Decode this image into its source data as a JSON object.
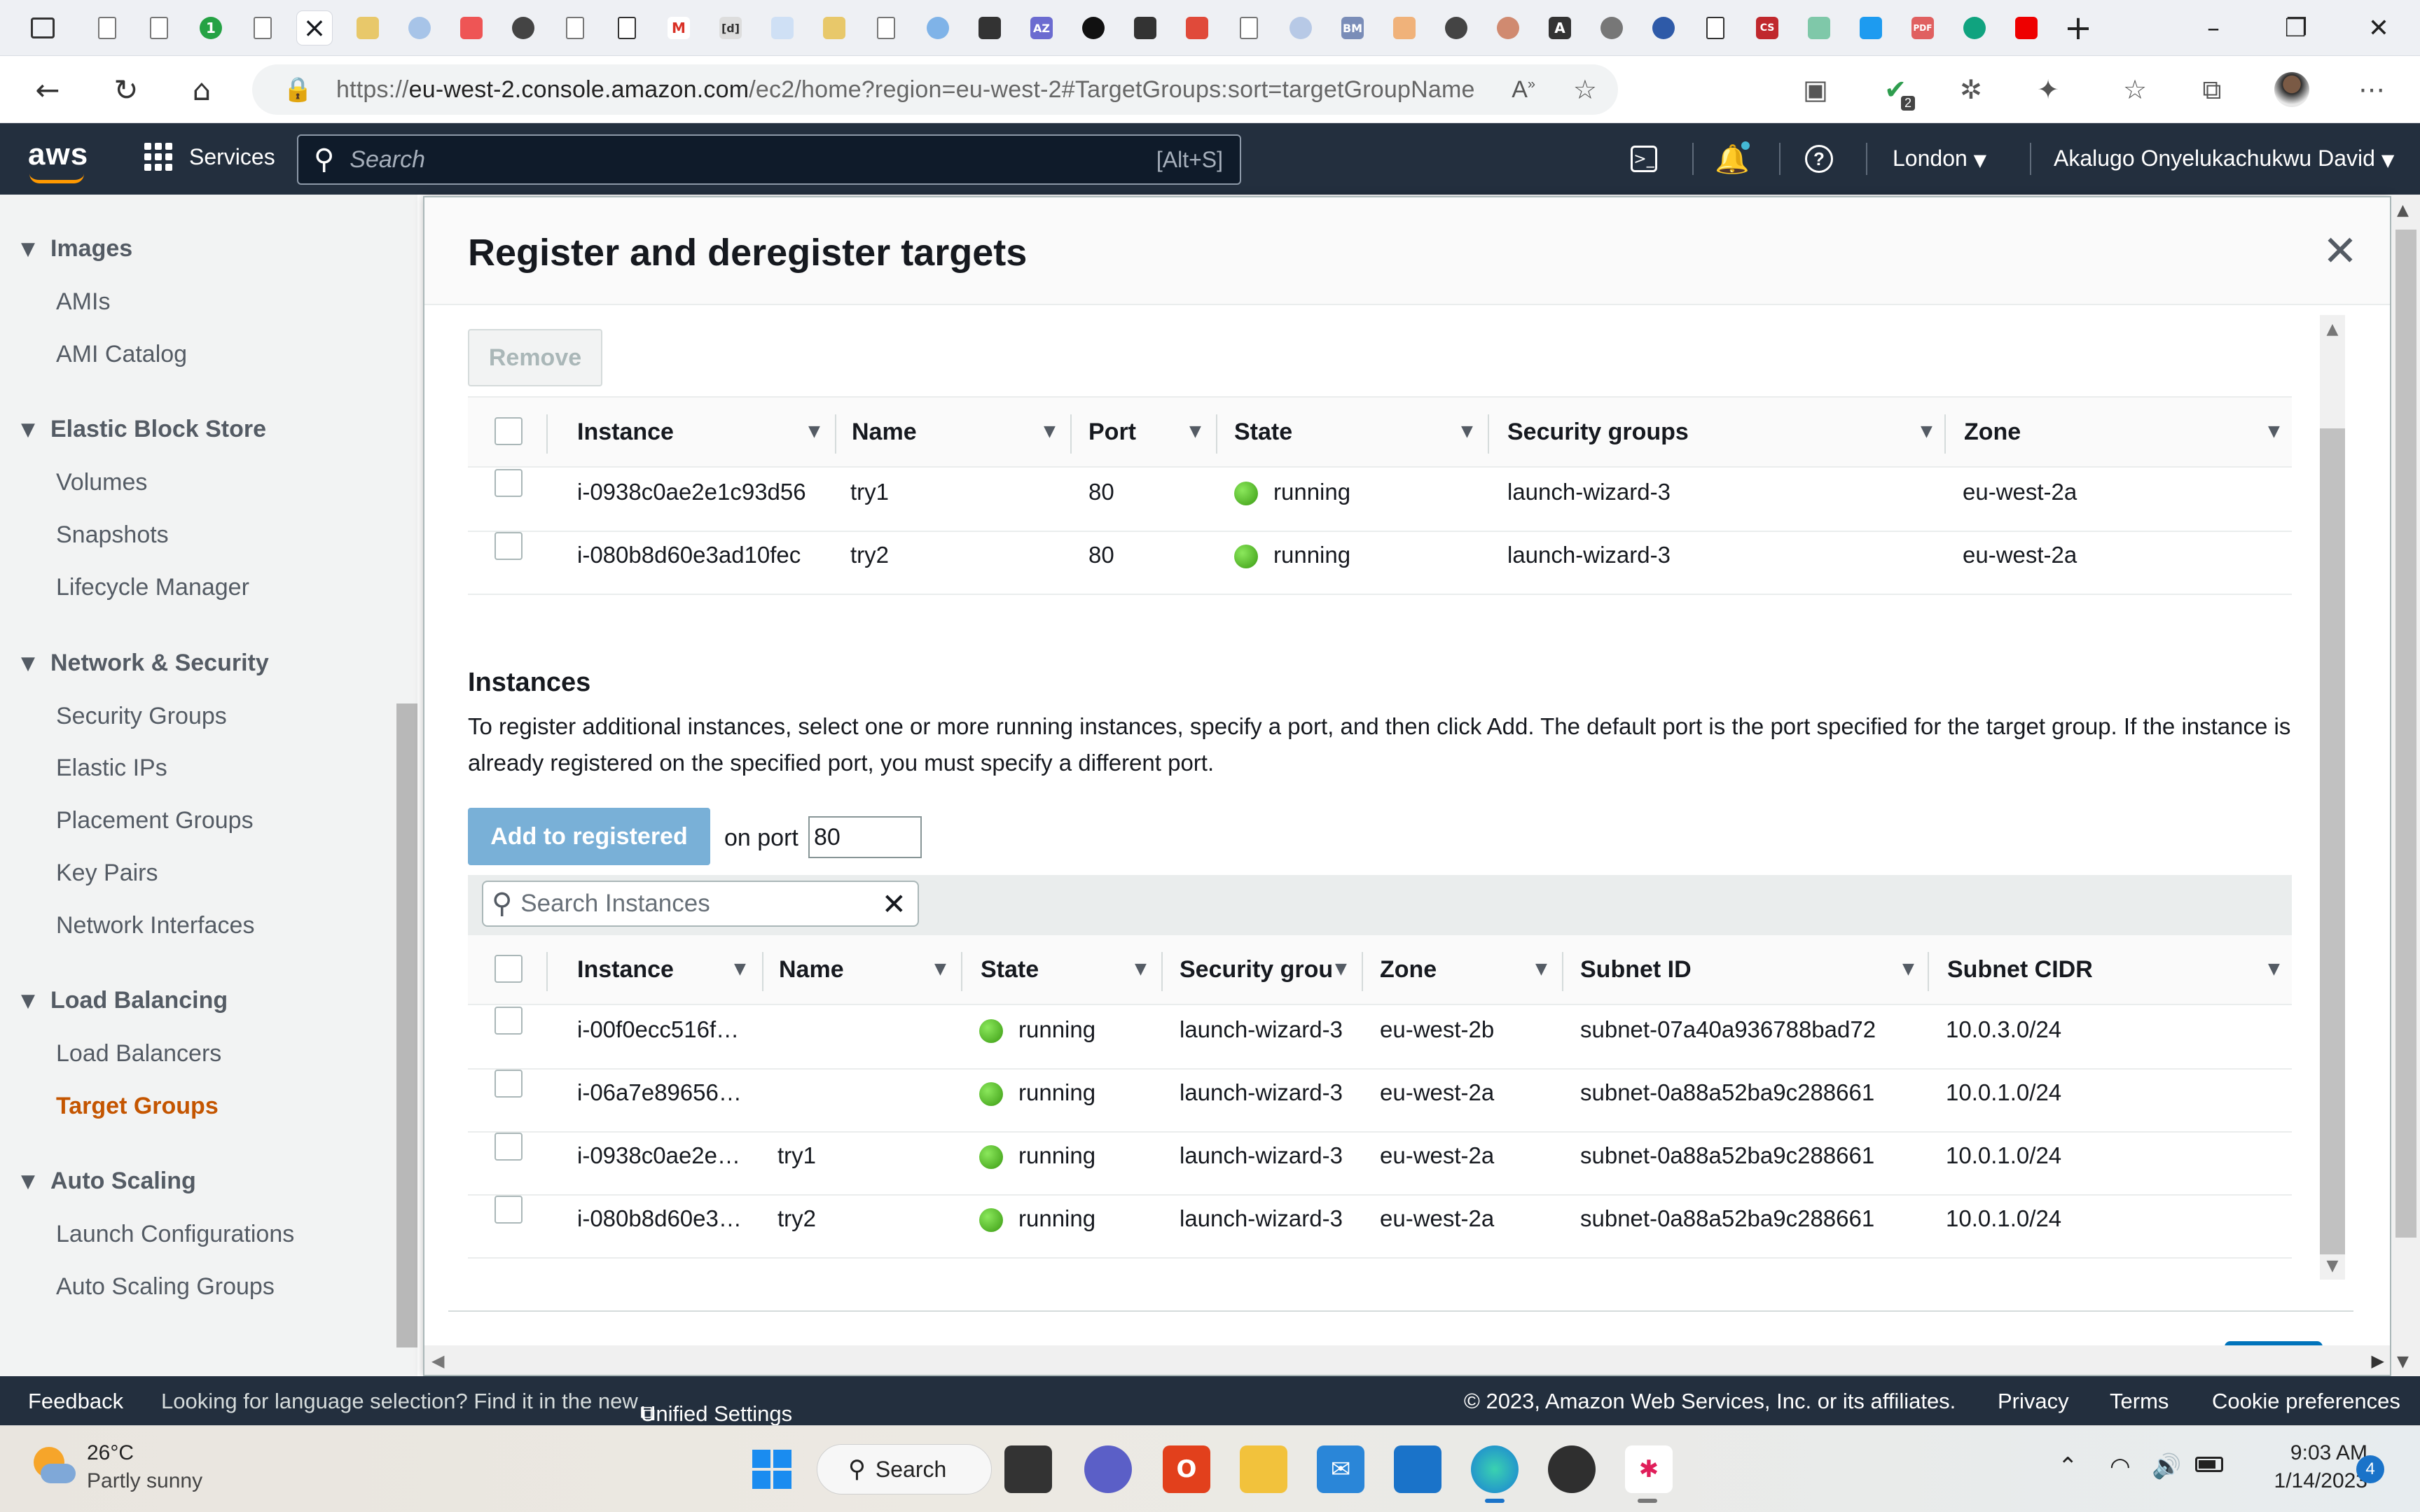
{
  "browser": {
    "url_prefix": "https://",
    "url_host": "eu-west-2.console.amazon.com",
    "url_path": "/ec2/home?region=eu-west-2#TargetGroups:sort=targetGroupName",
    "extensions_badge": "2",
    "tab_close": "×"
  },
  "aws_nav": {
    "logo": "aws",
    "services_label": "Services",
    "search_placeholder": "Search",
    "search_shortcut": "[Alt+S]",
    "region": "London",
    "user": "Akalugo Onyelukachukwu David"
  },
  "sidebar": {
    "sections": [
      {
        "title": "Images",
        "items": [
          "AMIs",
          "AMI Catalog"
        ]
      },
      {
        "title": "Elastic Block Store",
        "items": [
          "Volumes",
          "Snapshots",
          "Lifecycle Manager"
        ]
      },
      {
        "title": "Network & Security",
        "items": [
          "Security Groups",
          "Elastic IPs",
          "Placement Groups",
          "Key Pairs",
          "Network Interfaces"
        ]
      },
      {
        "title": "Load Balancing",
        "items": [
          "Load Balancers",
          "Target Groups"
        ]
      },
      {
        "title": "Auto Scaling",
        "items": [
          "Launch Configurations",
          "Auto Scaling Groups"
        ]
      }
    ],
    "active_item": "Target Groups"
  },
  "modal": {
    "title": "Register and deregister targets",
    "remove_label": "Remove",
    "registered": {
      "headers": [
        "Instance",
        "Name",
        "Port",
        "State",
        "Security groups",
        "Zone"
      ],
      "rows": [
        {
          "instance": "i-0938c0ae2e1c93d56",
          "name": "try1",
          "port": "80",
          "state": "running",
          "sg": "launch-wizard-3",
          "zone": "eu-west-2a"
        },
        {
          "instance": "i-080b8d60e3ad10fec",
          "name": "try2",
          "port": "80",
          "state": "running",
          "sg": "launch-wizard-3",
          "zone": "eu-west-2a"
        }
      ]
    },
    "instances_heading": "Instances",
    "instances_description": "To register additional instances, select one or more running instances, specify a port, and then click Add. The default port is the port specified for the target group. If the instance is already registered on the specified port, you must specify a different port.",
    "add_label": "Add to registered",
    "on_port_label": "on port",
    "port_value": "80",
    "search_placeholder": "Search Instances",
    "available": {
      "headers": [
        "Instance",
        "Name",
        "State",
        "Security grou",
        "Zone",
        "Subnet ID",
        "Subnet CIDR"
      ],
      "rows": [
        {
          "instance": "i-00f0ecc516f…",
          "name": "",
          "state": "running",
          "sg": "launch-wizard-3",
          "zone": "eu-west-2b",
          "subnet": "subnet-07a40a936788bad72",
          "cidr": "10.0.3.0/24"
        },
        {
          "instance": "i-06a7e89656…",
          "name": "",
          "state": "running",
          "sg": "launch-wizard-3",
          "zone": "eu-west-2a",
          "subnet": "subnet-0a88a52ba9c288661",
          "cidr": "10.0.1.0/24"
        },
        {
          "instance": "i-0938c0ae2e…",
          "name": "try1",
          "state": "running",
          "sg": "launch-wizard-3",
          "zone": "eu-west-2a",
          "subnet": "subnet-0a88a52ba9c288661",
          "cidr": "10.0.1.0/24"
        },
        {
          "instance": "i-080b8d60e3…",
          "name": "try2",
          "state": "running",
          "sg": "launch-wizard-3",
          "zone": "eu-west-2a",
          "subnet": "subnet-0a88a52ba9c288661",
          "cidr": "10.0.1.0/24"
        }
      ]
    }
  },
  "footer": {
    "feedback": "Feedback",
    "language_note": "Looking for language selection? Find it in the new",
    "unified_settings": "Unified Settings",
    "copyright": "© 2023, Amazon Web Services, Inc. or its affiliates.",
    "privacy": "Privacy",
    "terms": "Terms",
    "cookies": "Cookie preferences"
  },
  "taskbar": {
    "weather_temp": "26°C",
    "weather_desc": "Partly sunny",
    "search_label": "Search",
    "time": "9:03 AM",
    "date": "1/14/2023",
    "notification_count": "4"
  },
  "colors": {
    "aws_nav": "#232f3e",
    "aws_orange": "#ff9900",
    "active_link": "#c45500",
    "primary_button_disabled": "#79b0d7",
    "running_green": "#3a9a12"
  }
}
